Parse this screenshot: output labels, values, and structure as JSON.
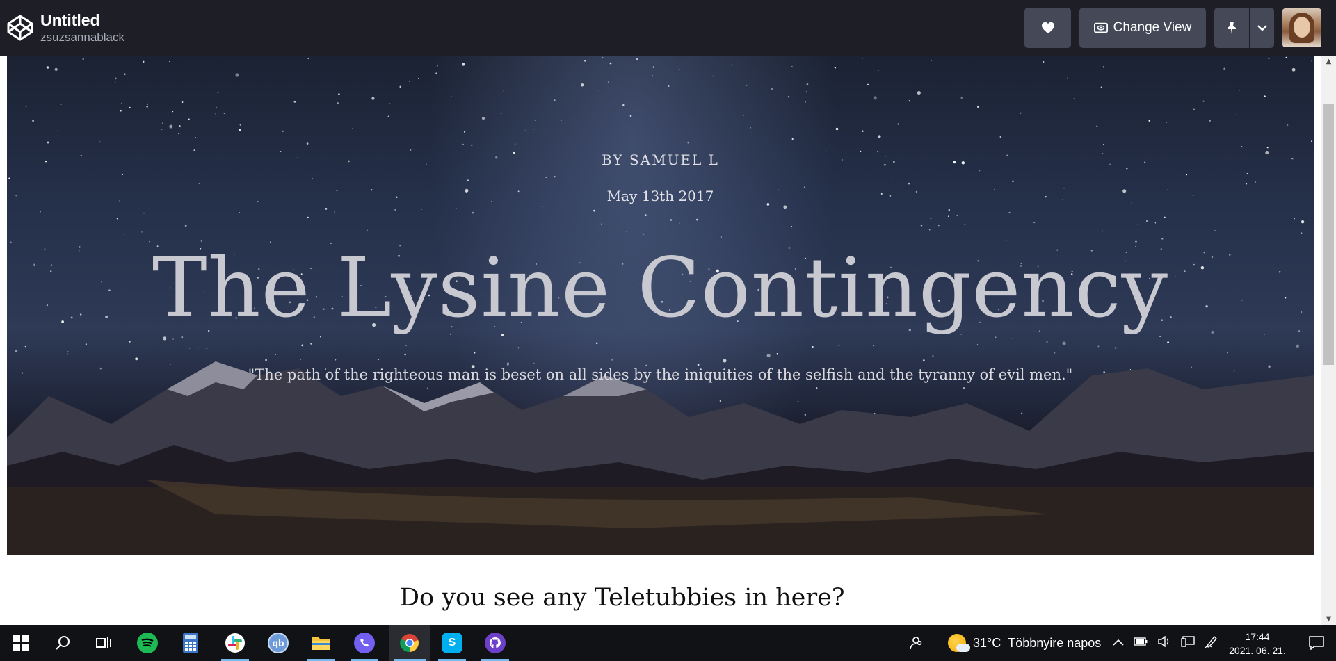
{
  "codepen": {
    "pen_title": "Untitled",
    "author": "zsuzsannablack",
    "buttons": {
      "like_icon": "heart-icon",
      "change_view_label": "Change View",
      "change_view_icon": "eye-icon",
      "pin_icon": "pin-icon",
      "pin_dropdown_icon": "chevron-down-icon"
    },
    "colors": {
      "bar_bg": "#1e1f26",
      "button_bg": "#444857"
    }
  },
  "hero": {
    "byline": "BY SAMUEL L",
    "date": "May 13th 2017",
    "title": "The Lysine Contingency",
    "quote": "\"The path of the righteous man is beset on all sides by the iniquities of the selfish and the tyranny of evil men.\""
  },
  "content": {
    "subheading": "Do you see any Teletubbies in here?"
  },
  "taskbar": {
    "apps": [
      {
        "name": "start",
        "icon": "windows-logo-icon"
      },
      {
        "name": "search",
        "icon": "search-icon"
      },
      {
        "name": "task-view",
        "icon": "task-view-icon"
      },
      {
        "name": "spotify",
        "icon": "spotify-icon"
      },
      {
        "name": "calculator",
        "icon": "calculator-icon"
      },
      {
        "name": "slack",
        "icon": "slack-icon"
      },
      {
        "name": "qbittorrent",
        "icon": "qbittorrent-icon",
        "label": "qb"
      },
      {
        "name": "file-explorer",
        "icon": "folder-icon"
      },
      {
        "name": "viber",
        "icon": "viber-icon"
      },
      {
        "name": "chrome",
        "icon": "chrome-icon"
      },
      {
        "name": "skype",
        "icon": "skype-icon",
        "label": "S"
      },
      {
        "name": "github",
        "icon": "github-icon"
      }
    ],
    "weather": {
      "temperature": "31°C",
      "condition": "Többnyire napos"
    },
    "clock": {
      "time": "17:44",
      "date": "2021. 06. 21."
    }
  }
}
